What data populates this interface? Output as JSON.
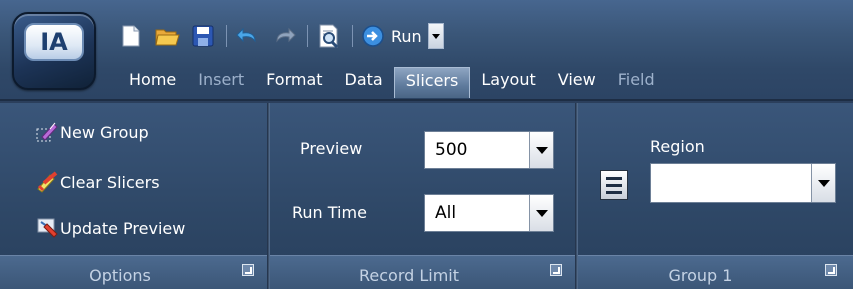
{
  "app": {
    "logo_text": "IA"
  },
  "quick_access": {
    "icons": [
      "new-document-icon",
      "open-folder-icon",
      "save-icon",
      "undo-icon",
      "redo-icon",
      "preview-icon"
    ],
    "run_label": "Run"
  },
  "tabs": [
    {
      "label": "Home",
      "state": "normal"
    },
    {
      "label": "Insert",
      "state": "disabled"
    },
    {
      "label": "Format",
      "state": "normal"
    },
    {
      "label": "Data",
      "state": "normal"
    },
    {
      "label": "Slicers",
      "state": "active"
    },
    {
      "label": "Layout",
      "state": "normal"
    },
    {
      "label": "View",
      "state": "normal"
    },
    {
      "label": "Field",
      "state": "disabled"
    }
  ],
  "groups": {
    "options": {
      "label": "Options",
      "items": [
        {
          "label": "New Group",
          "icon": "new-group-icon"
        },
        {
          "label": "Clear Slicers",
          "icon": "clear-slicers-icon"
        },
        {
          "label": "Update Preview",
          "icon": "update-preview-icon"
        }
      ]
    },
    "record_limit": {
      "label": "Record Limit",
      "preview_label": "Preview",
      "preview_value": "500",
      "runtime_label": "Run Time",
      "runtime_value": "All"
    },
    "group1": {
      "label": "Group 1",
      "region_label": "Region",
      "region_value": ""
    }
  }
}
